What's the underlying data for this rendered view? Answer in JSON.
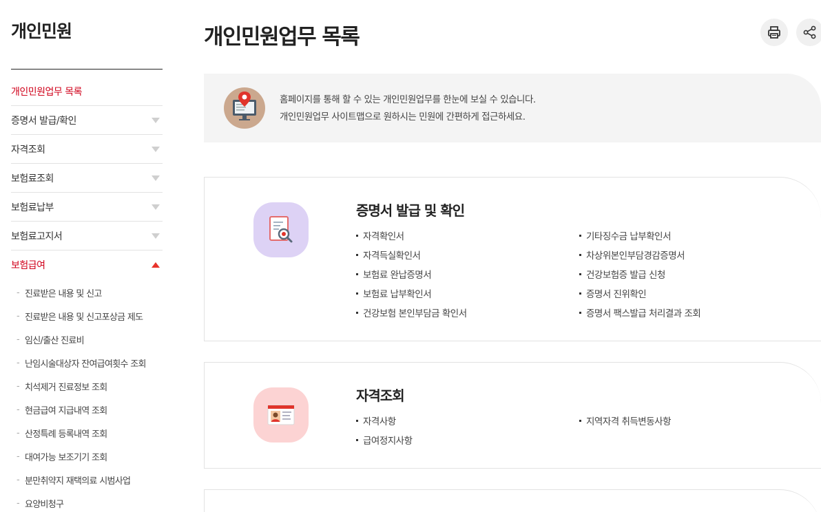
{
  "sidebar": {
    "title": "개인민원",
    "items": [
      {
        "label": "개인민원업무 목록",
        "active": true
      },
      {
        "label": "증명서 발급/확인"
      },
      {
        "label": "자격조회"
      },
      {
        "label": "보험료조회"
      },
      {
        "label": "보험료납부"
      },
      {
        "label": "보험료고지서"
      },
      {
        "label": "보험급여",
        "active": true,
        "open": true
      }
    ],
    "submenu": [
      "진료받은 내용 및 신고",
      "진료받은 내용 및 신고포상금 제도",
      "임신/출산 진료비",
      "난임시술대상자 잔여급여횟수 조회",
      "치석제거 진료정보 조회",
      "현금급여 지급내역 조회",
      "산정특례 등록내역 조회",
      "대여가능 보조기기 조회",
      "분만취약지 재택의료 시범사업",
      "요양비청구"
    ]
  },
  "main": {
    "title": "개인민원업무 목록",
    "intro": {
      "line1": "홈페이지를 통해 할 수 있는 개인민원업무를 한눈에 보실 수 있습니다.",
      "line2": "개인민원업무 사이트맵으로 원하시는 민원에 간편하게 접근하세요."
    },
    "sections": [
      {
        "title": "증명서 발급 및 확인",
        "items": [
          "자격확인서",
          "기타징수금 납부확인서",
          "자격득실확인서",
          "차상위본인부담경감증명서",
          "보험료 완납증명서",
          "건강보험증 발급 신청",
          "보험료 납부확인서",
          "증명서 진위확인",
          "건강보험 본인부담금 확인서",
          "증명서 팩스발급 처리결과 조회"
        ]
      },
      {
        "title": "자격조회",
        "items": [
          "자격사항",
          "지역자격 취득변동사항",
          "급여정지사항"
        ]
      }
    ]
  },
  "icons": {
    "print": "printer-icon",
    "share": "share-icon"
  },
  "colors": {
    "accent": "#d0021b",
    "cert_icon_bg": "#ddd2f5",
    "qual_icon_bg": "#fcd3d3",
    "intro_icon_bg": "#cba88e"
  }
}
